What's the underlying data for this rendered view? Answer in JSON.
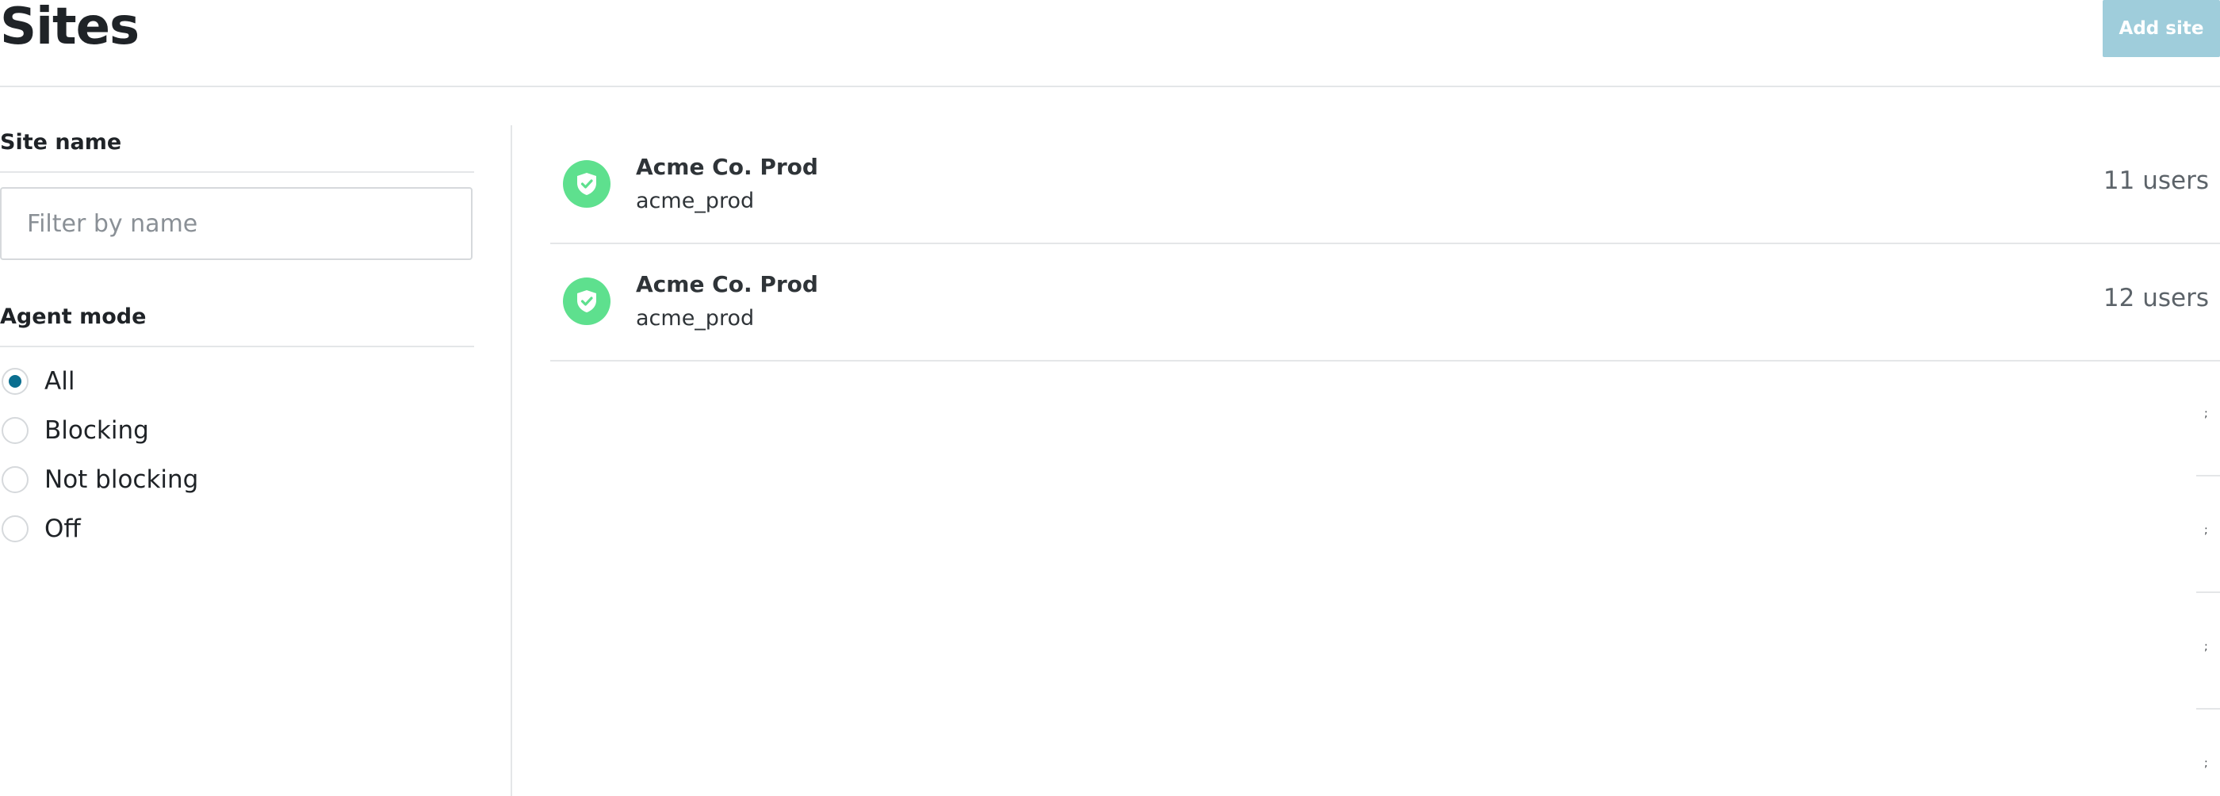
{
  "header": {
    "title": "Sites",
    "add_site_label": "Add site"
  },
  "filters": {
    "site_name": {
      "heading": "Site name",
      "placeholder": "Filter by name",
      "value": ""
    },
    "agent_mode": {
      "heading": "Agent mode",
      "options": [
        {
          "label": "All",
          "selected": true
        },
        {
          "label": "Blocking",
          "selected": false
        },
        {
          "label": "Not blocking",
          "selected": false
        },
        {
          "label": "Off",
          "selected": false
        }
      ]
    }
  },
  "sites": [
    {
      "name": "Acme Co. Prod",
      "slug": "acme_prod",
      "users": "11 users",
      "status_icon": "shield-check-icon"
    },
    {
      "name": "Acme Co. Prod",
      "slug": "acme_prod",
      "users": "12 users",
      "status_icon": "shield-check-icon"
    }
  ],
  "skeleton_rows": [
    ";",
    ";",
    ";",
    ";"
  ],
  "colors": {
    "accent": "#0a6e8f",
    "button": "#9fcddb",
    "status_ok": "#5ee08e"
  }
}
